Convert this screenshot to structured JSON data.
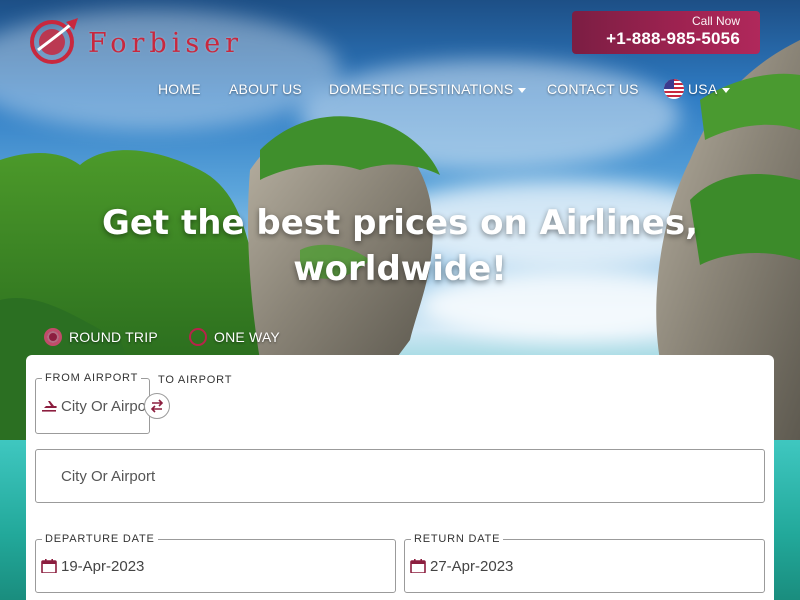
{
  "brand": {
    "name": "Forbiser",
    "accent": "#c8283e",
    "deep": "#8c1e3f"
  },
  "call": {
    "label": "Call Now",
    "number": "+1-888-985-5056"
  },
  "nav": {
    "home": "HOME",
    "about": "ABOUT US",
    "domestic": "DOMESTIC DESTINATIONS",
    "contact": "CONTACT US",
    "country": "USA"
  },
  "hero": {
    "line1": "Get the best prices on Airlines,",
    "line2": "worldwide!"
  },
  "trip": {
    "round": "ROUND TRIP",
    "oneway": "ONE WAY",
    "selected": "round"
  },
  "form": {
    "from_label": "FROM AIRPORT",
    "from_placeholder": "City Or Airport",
    "to_label": "TO AIRPORT",
    "to_placeholder": "City Or Airport",
    "departure_label": "DEPARTURE DATE",
    "departure_value": "19-Apr-2023",
    "return_label": "RETURN DATE",
    "return_value": "27-Apr-2023"
  },
  "icons": {
    "logo": "plane-globe-logo",
    "from": "plane-departure-icon",
    "swap": "swap-arrows-icon",
    "calendar": "calendar-icon",
    "flag": "usa-flag-icon"
  }
}
